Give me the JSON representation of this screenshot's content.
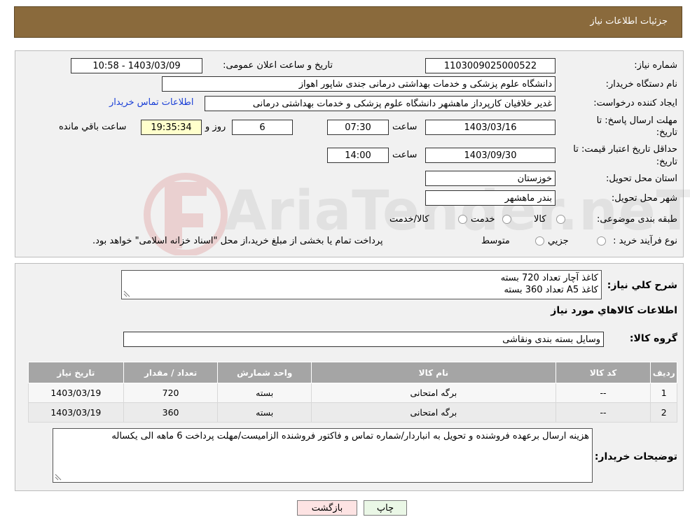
{
  "header": {
    "title": "جزئیات اطلاعات نیاز"
  },
  "form": {
    "need_number_label": "شماره نیاز:",
    "need_number": "1103009025000522",
    "announce_label": "تاریخ و ساعت اعلان عمومی:",
    "announce_value": "1403/03/09 - 10:58",
    "buyer_org_label": "نام دستگاه خریدار:",
    "buyer_org": "دانشگاه علوم پزشکی و خدمات بهداشتی درمانی جندی شاپور اهواز",
    "creator_label": "ایجاد کننده درخواست:",
    "creator": "غدیر خلافیان کارپرداز ماهشهر دانشگاه علوم پزشکی و خدمات بهداشتی درمانی",
    "contact_link": "اطلاعات تماس خریدار",
    "deadline_label_line1": "مهلت ارسال پاسخ: تا",
    "deadline_label_line2": "تاریخ:",
    "deadline_date": "1403/03/16",
    "time_label": "ساعت",
    "deadline_time": "07:30",
    "days_value": "6",
    "days_label": "روز و",
    "remaining_time": "19:35:34",
    "remaining_label": "ساعت باقي مانده",
    "validity_label_line1": "حداقل تاریخ اعتبار قیمت: تا",
    "validity_label_line2": "تاریخ:",
    "validity_date": "1403/09/30",
    "validity_time": "14:00",
    "province_label": "استان محل تحویل:",
    "province": "خوزستان",
    "city_label": "شهر محل تحویل:",
    "city": "بندر ماهشهر",
    "category_label": "طبقه بندی موضوعی:",
    "category_options": [
      "کالا",
      "خدمت",
      "کالا/خدمت"
    ],
    "process_label": "نوع فرآیند خرید :",
    "process_options": [
      "جزیي",
      "متوسط"
    ],
    "process_note": "پرداخت تمام یا بخشی از مبلغ خرید،از محل \"اسناد خزانه اسلامی\" خواهد بود."
  },
  "description": {
    "label": "شرح کلي نياز:",
    "line1": "کاغذ آچار تعداد 720 بسته",
    "line2": "کاغذ A5 تعداد 360 بسته"
  },
  "goods": {
    "section_title": "اطلاعات کالاهاي مورد نياز",
    "group_label": "گروه کالا:",
    "group_value": "وسایل بسته بندی  ونقاشی",
    "columns": [
      "ردیف",
      "کد کالا",
      "نام کالا",
      "واحد شمارش",
      "تعداد / مقدار",
      "تاریخ نیاز"
    ],
    "rows": [
      [
        "1",
        "--",
        "برگه امتحانی",
        "بسته",
        "720",
        "1403/03/19"
      ],
      [
        "2",
        "--",
        "برگه امتحانی",
        "بسته",
        "360",
        "1403/03/19"
      ]
    ]
  },
  "buyer_notes": {
    "label": "توضیحات خریدار:",
    "text": "هزینه ارسال برعهده فروشنده و تحویل به انباردار/شماره تماس و فاکتور فروشنده الزامیست/مهلت پرداخت 6 ماهه الی یکساله"
  },
  "buttons": {
    "print": "چاپ",
    "back": "بازگشت"
  },
  "watermark": {
    "text": "AriaTender.neT"
  },
  "colors": {
    "header": "#8a6a3c",
    "link": "#1a3fd6",
    "remaining_bg": "#ffffcc",
    "back_bg": "#fde3e3",
    "print_bg": "#eaf7e6"
  }
}
